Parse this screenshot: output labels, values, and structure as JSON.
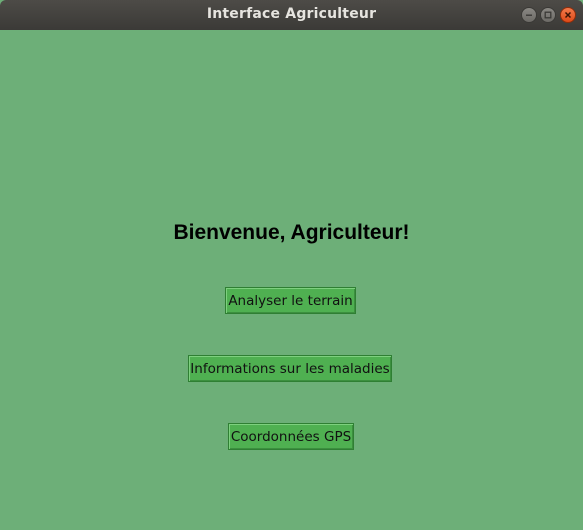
{
  "window": {
    "title": "Interface Agriculteur",
    "controls": [
      "minimize-icon",
      "maximize-icon",
      "close-icon"
    ]
  },
  "main": {
    "heading": "Bienvenue, Agriculteur!",
    "buttons": [
      {
        "label": "Analyser le terrain"
      },
      {
        "label": "Informations sur les maladies"
      },
      {
        "label": "Coordonnées GPS"
      }
    ]
  },
  "colors": {
    "background": "#6daf78",
    "button": "#4fb051",
    "titlebar": "#3f3e3b",
    "close": "#e95420"
  }
}
